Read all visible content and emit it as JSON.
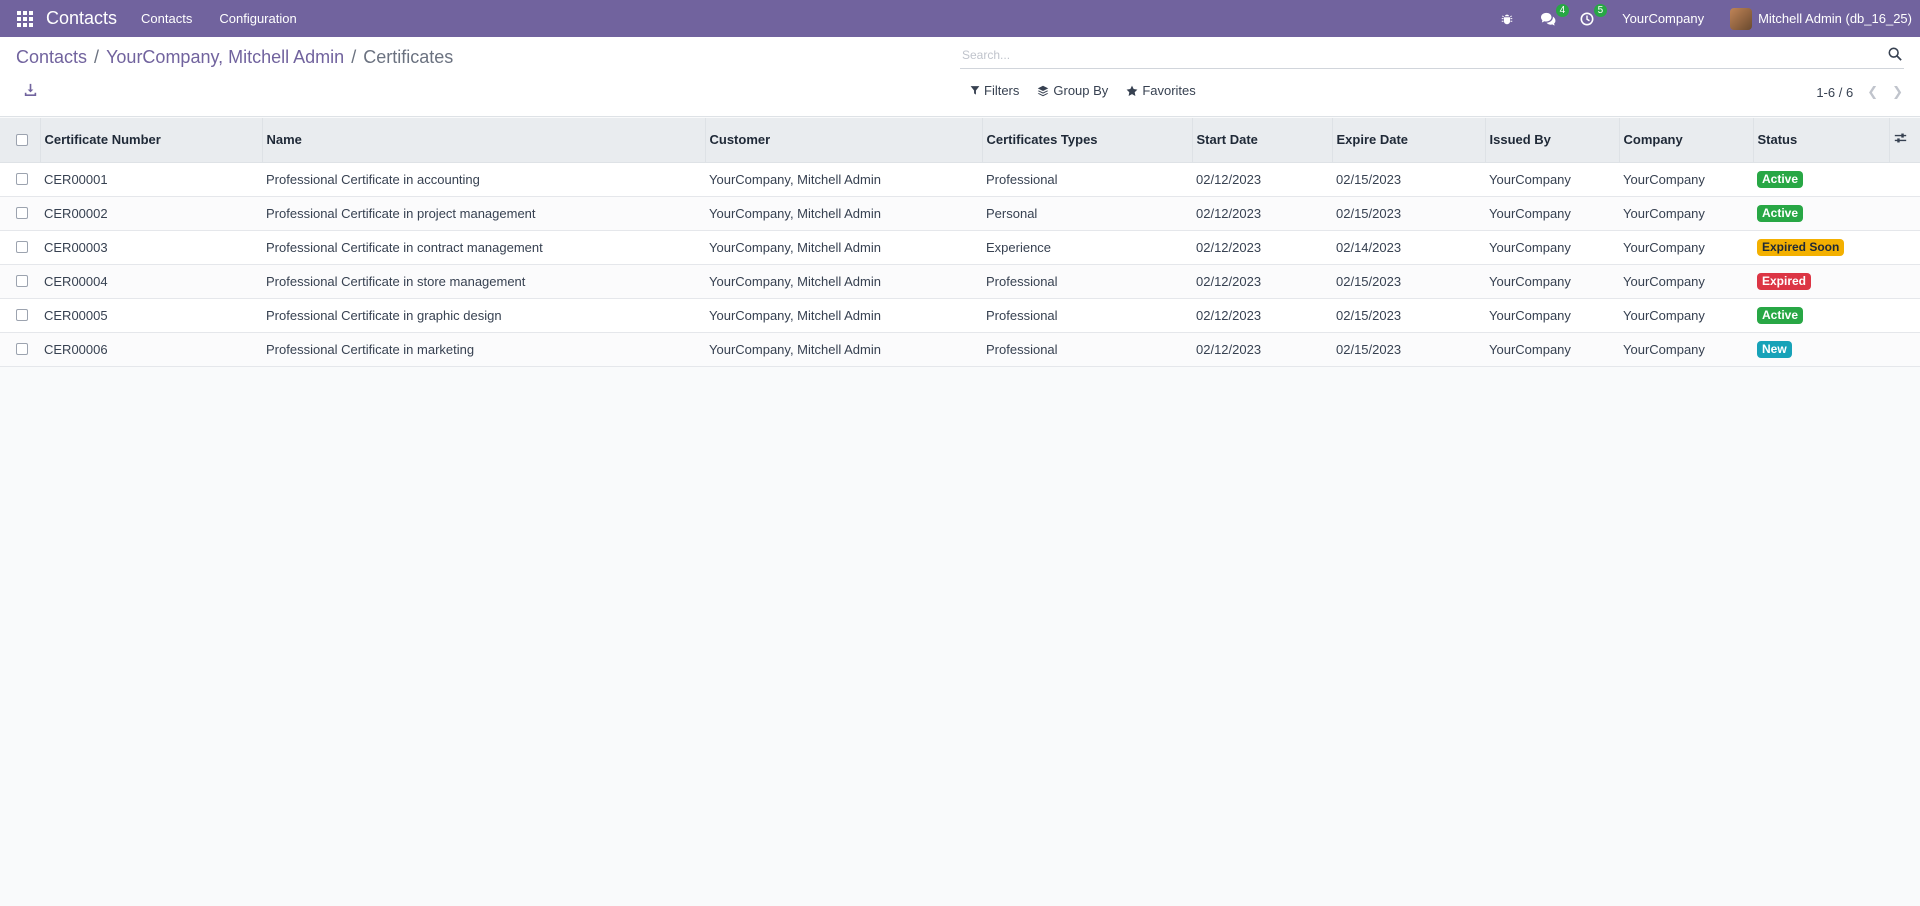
{
  "navbar": {
    "app_name": "Contacts",
    "menus": [
      "Contacts",
      "Configuration"
    ],
    "chat_count": "4",
    "activity_count": "5",
    "company": "YourCompany",
    "user": "Mitchell Admin (db_16_25)"
  },
  "breadcrumb": {
    "items": [
      "Contacts",
      "YourCompany, Mitchell Admin",
      "Certificates"
    ]
  },
  "search": {
    "placeholder": "Search..."
  },
  "filters": {
    "filters_label": "Filters",
    "groupby_label": "Group By",
    "favorites_label": "Favorites"
  },
  "pager": {
    "text": "1-6 / 6"
  },
  "table": {
    "headers": [
      "Certificate Number",
      "Name",
      "Customer",
      "Certificates Types",
      "Start Date",
      "Expire Date",
      "Issued By",
      "Company",
      "Status"
    ],
    "rows": [
      [
        "CER00001",
        "Professional Certificate in accounting",
        "YourCompany, Mitchell Admin",
        "Professional",
        "02/12/2023",
        "02/15/2023",
        "YourCompany",
        "YourCompany",
        "Active"
      ],
      [
        "CER00002",
        "Professional Certificate in project management",
        "YourCompany, Mitchell Admin",
        "Personal",
        "02/12/2023",
        "02/15/2023",
        "YourCompany",
        "YourCompany",
        "Active"
      ],
      [
        "CER00003",
        "Professional Certificate in contract management",
        "YourCompany, Mitchell Admin",
        "Experience",
        "02/12/2023",
        "02/14/2023",
        "YourCompany",
        "YourCompany",
        "Expired Soon"
      ],
      [
        "CER00004",
        "Professional Certificate in store management",
        "YourCompany, Mitchell Admin",
        "Professional",
        "02/12/2023",
        "02/15/2023",
        "YourCompany",
        "YourCompany",
        "Expired"
      ],
      [
        "CER00005",
        "Professional Certificate in graphic design",
        "YourCompany, Mitchell Admin",
        "Professional",
        "02/12/2023",
        "02/15/2023",
        "YourCompany",
        "YourCompany",
        "Active"
      ],
      [
        "CER00006",
        "Professional Certificate in marketing",
        "YourCompany, Mitchell Admin",
        "Professional",
        "02/12/2023",
        "02/15/2023",
        "YourCompany",
        "YourCompany",
        "New"
      ]
    ]
  },
  "status_colors": {
    "Active": {
      "bg": "#28a745",
      "fg": "#ffffff"
    },
    "Expired Soon": {
      "bg": "#f3b000",
      "fg": "#1f2937"
    },
    "Expired": {
      "bg": "#dc3545",
      "fg": "#ffffff"
    },
    "New": {
      "bg": "#17a2b8",
      "fg": "#ffffff"
    }
  },
  "colors": {
    "navbar": "#71639e",
    "accent": "#71639e"
  }
}
